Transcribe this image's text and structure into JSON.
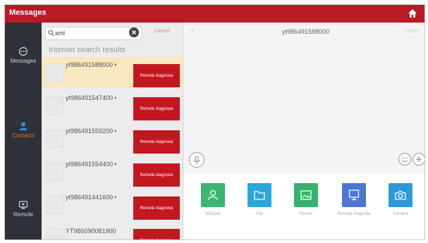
{
  "header": {
    "title": "Messages"
  },
  "sidebar": {
    "items": [
      {
        "label": "Messages",
        "icon": "chat-icon"
      },
      {
        "label": "Contacts",
        "icon": "contacts-icon",
        "active": true
      },
      {
        "label": "Remote",
        "icon": "remote-icon"
      }
    ]
  },
  "search": {
    "value": "xml",
    "cancel_label": "Cancel"
  },
  "results_header": "Internet search results",
  "contacts": [
    {
      "name": "yt986491588000",
      "dot": "•",
      "button": "Remote diagnose"
    },
    {
      "name": "yt986491547400",
      "dot": "•",
      "button": "Remote diagnose"
    },
    {
      "name": "yt986491559200",
      "dot": "•",
      "button": "Remote diagnose"
    },
    {
      "name": "yt986491554400",
      "dot": "•",
      "button": "Remote diagnose"
    },
    {
      "name": "yt986491441600",
      "dot": "•",
      "button": "Remote diagnose"
    },
    {
      "name": "YT986090081900",
      "dot": "",
      "button": "Remote diagnose"
    }
  ],
  "chat": {
    "title": "yt986491588000",
    "close": "×",
    "action": "Delete"
  },
  "tray": [
    {
      "label": "MyData",
      "icon": "person-icon",
      "color": "#3cb56f"
    },
    {
      "label": "File",
      "icon": "folder-icon",
      "color": "#2ba7dc"
    },
    {
      "label": "Picture",
      "icon": "picture-icon",
      "color": "#35b36b"
    },
    {
      "label": "Remote diagnose",
      "icon": "monitor-icon",
      "color": "#4a76d6"
    },
    {
      "label": "Camera",
      "icon": "camera-icon",
      "color": "#2c9ad8"
    }
  ],
  "colors": {
    "header": "#b91a26",
    "sidebar": "#2e3238",
    "active": "#f06a1d",
    "button": "#c3171f",
    "highlight": "#f8e8bf"
  }
}
